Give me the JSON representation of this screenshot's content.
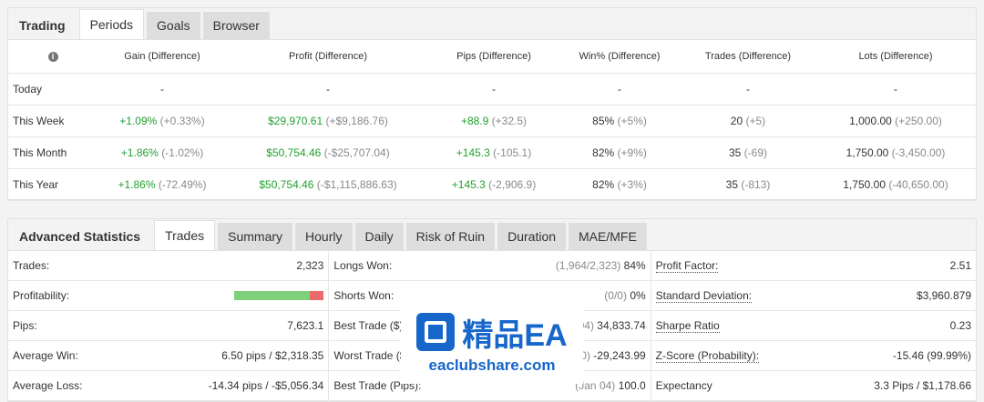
{
  "top_tabs": {
    "title": "Trading",
    "items": [
      "Periods",
      "Goals",
      "Browser"
    ],
    "active": "Periods"
  },
  "periods": {
    "info_icon": "i",
    "headers": [
      "Gain (Difference)",
      "Profit (Difference)",
      "Pips (Difference)",
      "Win% (Difference)",
      "Trades (Difference)",
      "Lots (Difference)"
    ],
    "rows": [
      {
        "label": "Today",
        "gain": "-",
        "gain_diff": "",
        "profit": "-",
        "profit_diff": "",
        "pips": "-",
        "pips_diff": "",
        "win": "-",
        "win_diff": "",
        "trades": "-",
        "trades_diff": "",
        "lots": "-",
        "lots_diff": ""
      },
      {
        "label": "This Week",
        "gain": "+1.09%",
        "gain_diff": "(+0.33%)",
        "profit": "$29,970.61",
        "profit_diff": "(+$9,186.76)",
        "pips": "+88.9",
        "pips_diff": "(+32.5)",
        "win": "85%",
        "win_diff": "(+5%)",
        "trades": "20",
        "trades_diff": "(+5)",
        "lots": "1,000.00",
        "lots_diff": "(+250.00)"
      },
      {
        "label": "This Month",
        "gain": "+1.86%",
        "gain_diff": "(-1.02%)",
        "profit": "$50,754.46",
        "profit_diff": "(-$25,707.04)",
        "pips": "+145.3",
        "pips_diff": "(-105.1)",
        "win": "82%",
        "win_diff": "(+9%)",
        "trades": "35",
        "trades_diff": "(-69)",
        "lots": "1,750.00",
        "lots_diff": "(-3,450.00)"
      },
      {
        "label": "This Year",
        "gain": "+1.86%",
        "gain_diff": "(-72.49%)",
        "profit": "$50,754.46",
        "profit_diff": "(-$1,115,886.63)",
        "pips": "+145.3",
        "pips_diff": "(-2,906.9)",
        "win": "82%",
        "win_diff": "(+3%)",
        "trades": "35",
        "trades_diff": "(-813)",
        "lots": "1,750.00",
        "lots_diff": "(-40,650.00)"
      }
    ]
  },
  "adv_tabs": {
    "title": "Advanced Statistics",
    "items": [
      "Trades",
      "Summary",
      "Hourly",
      "Daily",
      "Risk of Ruin",
      "Duration",
      "MAE/MFE"
    ],
    "active": "Trades"
  },
  "stats": {
    "col1": [
      {
        "label": "Trades:",
        "value": "2,323"
      },
      {
        "label": "Profitability:",
        "value": "",
        "win_fraction": 0.84
      },
      {
        "label": "Pips:",
        "value": "7,623.1"
      },
      {
        "label": "Average Win:",
        "value": "6.50 pips / $2,318.35"
      },
      {
        "label": "Average Loss:",
        "value": "-14.34 pips / -$5,056.34"
      }
    ],
    "col2": [
      {
        "label": "Longs Won:",
        "value_muted": "(1,964/2,323)",
        "value": "84%"
      },
      {
        "label": "Shorts Won:",
        "value_muted": "(0/0)",
        "value": "0%"
      },
      {
        "label": "Best Trade ($):",
        "value_muted": "04)",
        "value": "34,833.74"
      },
      {
        "label": "Worst Trade ($):",
        "value_muted": "0)",
        "value": "-29,243.99"
      },
      {
        "label": "Best Trade (Pips):",
        "value_muted": "(Jan 04)",
        "value": "100.0"
      }
    ],
    "col3": [
      {
        "label": "Profit Factor:",
        "value": "2.51"
      },
      {
        "label": "Standard Deviation:",
        "value": "$3,960.879"
      },
      {
        "label": "Sharpe Ratio",
        "value": "0.23"
      },
      {
        "label": "Z-Score (Probability):",
        "value": "-15.46 (99.99%)"
      },
      {
        "label": "Expectancy",
        "value": "3.3 Pips / $1,178.66"
      }
    ]
  },
  "watermark": {
    "title": "精品EA",
    "url": "eaclubshare.com"
  },
  "colors": {
    "positive": "#22a12f",
    "muted": "#8a8a8a",
    "win_bar": "#7fd07a",
    "loss_bar": "#ea6b6b",
    "brand": "#1766c9"
  }
}
